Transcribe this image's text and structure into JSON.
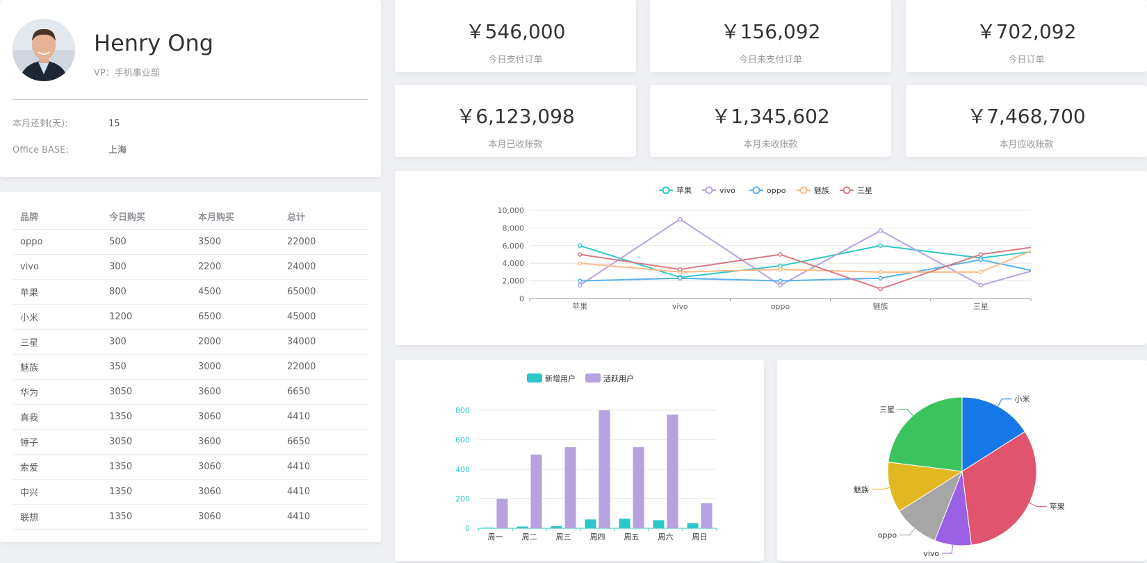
{
  "profile": {
    "name": "Henry Ong",
    "role": "VP：手机事业部",
    "rows": [
      {
        "key": "本月还剩(天):",
        "value": "15"
      },
      {
        "key": "Office BASE:",
        "value": "上海"
      }
    ]
  },
  "stats": [
    {
      "amount": "￥546,000",
      "label": "今日支付订单"
    },
    {
      "amount": "￥156,092",
      "label": "今日未支付订单"
    },
    {
      "amount": "￥702,092",
      "label": "今日订单"
    },
    {
      "amount": "￥6,123,098",
      "label": "本月已收账款"
    },
    {
      "amount": "￥1,345,602",
      "label": "本月未收账款"
    },
    {
      "amount": "￥7,468,700",
      "label": "本月应收账款"
    }
  ],
  "table": {
    "headers": [
      "品牌",
      "今日购买",
      "本月购买",
      "总计"
    ],
    "rows": [
      [
        "oppo",
        "500",
        "3500",
        "22000"
      ],
      [
        "vivo",
        "300",
        "2200",
        "24000"
      ],
      [
        "苹果",
        "800",
        "4500",
        "65000"
      ],
      [
        "小米",
        "1200",
        "6500",
        "45000"
      ],
      [
        "三星",
        "300",
        "2000",
        "34000"
      ],
      [
        "魅族",
        "350",
        "3000",
        "22000"
      ],
      [
        "华为",
        "3050",
        "3600",
        "6650"
      ],
      [
        "真我",
        "1350",
        "3060",
        "4410"
      ],
      [
        "锤子",
        "3050",
        "3600",
        "6650"
      ],
      [
        "索爱",
        "1350",
        "3060",
        "4410"
      ],
      [
        "中兴",
        "1350",
        "3060",
        "4410"
      ],
      [
        "联想",
        "1350",
        "3060",
        "4410"
      ]
    ]
  },
  "chart_data": [
    {
      "type": "line",
      "categories": [
        "苹果",
        "vivo",
        "oppo",
        "魅族",
        "三星"
      ],
      "ylim": [
        0,
        10000
      ],
      "yticks": [
        "0",
        "2,000",
        "4,000",
        "6,000",
        "8,000",
        "10,000"
      ],
      "legend_position": "top-center",
      "grid": true,
      "series": [
        {
          "name": "苹果",
          "color": "#2ec7c9",
          "values": [
            6000,
            2400,
            3700,
            6000,
            4600,
            5300
          ]
        },
        {
          "name": "vivo",
          "color": "#b6a2de",
          "values": [
            1500,
            9000,
            1500,
            7700,
            1500,
            3100
          ]
        },
        {
          "name": "oppo",
          "color": "#5ab1ef",
          "values": [
            2000,
            2300,
            2000,
            2300,
            4400,
            3200
          ]
        },
        {
          "name": "魅族",
          "color": "#ffb980",
          "values": [
            4000,
            3000,
            3300,
            3000,
            3000,
            5400
          ]
        },
        {
          "name": "三星",
          "color": "#d87a80",
          "values": [
            5000,
            3300,
            5000,
            1100,
            5000,
            5800
          ]
        }
      ]
    },
    {
      "type": "bar",
      "categories": [
        "周一",
        "周二",
        "周三",
        "周四",
        "周五",
        "周六",
        "周日"
      ],
      "ylim": [
        0,
        800
      ],
      "yticks": [
        "0",
        "200",
        "400",
        "600",
        "800"
      ],
      "legend_position": "top-center",
      "series": [
        {
          "name": "新增用户",
          "color": "#2ec7c9",
          "values": [
            5,
            12,
            15,
            60,
            65,
            55,
            35
          ]
        },
        {
          "name": "活跃用户",
          "color": "#b6a2de",
          "values": [
            200,
            500,
            550,
            800,
            550,
            770,
            170
          ]
        }
      ]
    },
    {
      "type": "pie",
      "slices": [
        {
          "label": "小米",
          "value": 16,
          "color": "#1677e8"
        },
        {
          "label": "苹果",
          "value": 32,
          "color": "#e0546d"
        },
        {
          "label": "vivo",
          "value": 8,
          "color": "#9b60e6"
        },
        {
          "label": "oppo",
          "value": 10,
          "color": "#a6a6a6"
        },
        {
          "label": "魅族",
          "value": 11,
          "color": "#e2b822"
        },
        {
          "label": "三星",
          "value": 23,
          "color": "#3bc45e"
        }
      ]
    }
  ]
}
